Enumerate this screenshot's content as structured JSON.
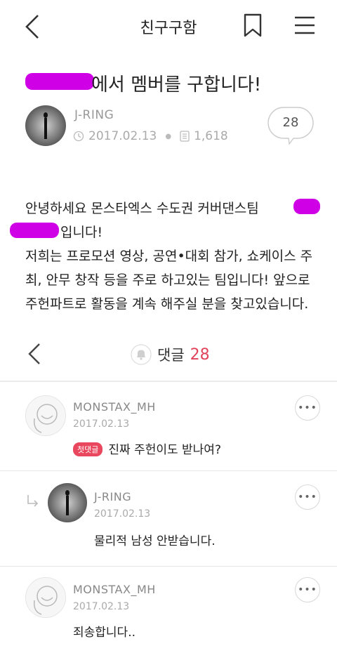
{
  "header": {
    "title": "친구구함",
    "back_icon": "chevron-left-icon",
    "bookmark_icon": "bookmark-icon",
    "menu_icon": "hamburger-menu-icon"
  },
  "post": {
    "title_suffix": "에서 멤버를 구합니다!",
    "author": "J-RING",
    "date": "2017.02.13",
    "views": "1,618",
    "comment_count_bubble": "28",
    "body_paragraphs": [
      "안녕하세요 몬스타엑스 수도권 커버댄스팀",
      "입니다!",
      "저희는 프로모션 영상, 공연•대회 참가, 쇼케이스 주최, 안무 창작 등을 주로 하고있는 팀입니다! 앞으로 주헌파트로 활동을 계속 해주실 분을 찾고있습니다."
    ]
  },
  "comments_header": {
    "label": "댓글",
    "count": "28"
  },
  "comments": [
    {
      "author": "MONSTAX_MH",
      "date": "2017.02.13",
      "badge": "첫댓글",
      "text": "진짜 주헌이도 받나여?"
    },
    {
      "author": "J-RING",
      "date": "2017.02.13",
      "text": "물리적 남성 안받습니다.",
      "is_reply": true
    },
    {
      "author": "MONSTAX_MH",
      "date": "2017.02.13",
      "text": "죄송합니다.."
    }
  ],
  "colors": {
    "accent": "#e0435a",
    "redaction": "#d000e6"
  }
}
